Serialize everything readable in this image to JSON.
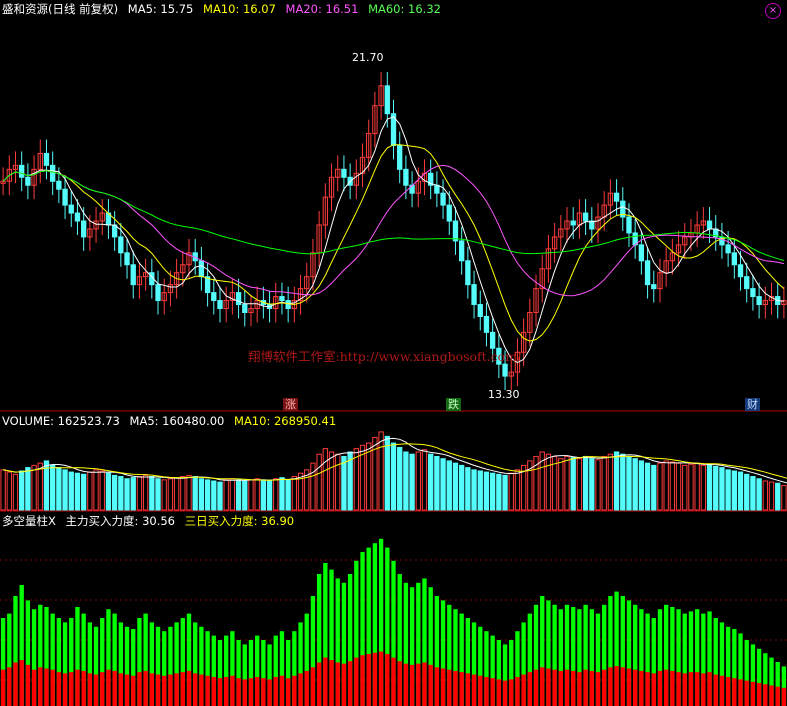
{
  "header": {
    "title": "盛和资源(日线 前复权)",
    "ma5": "MA5: 15.75",
    "ma10": "MA10: 16.07",
    "ma20": "MA20: 16.51",
    "ma60": "MA60: 16.32"
  },
  "volume_header": {
    "volume": "VOLUME: 162523.73",
    "ma5": "MA5: 160480.00",
    "ma10": "MA10: 268950.41"
  },
  "indicator_header": {
    "name": "多空量柱X",
    "main_force": "主力买入力度: 30.56",
    "three_day": "三日买入力度: 36.90"
  },
  "signals": {
    "zhang": "涨",
    "die": "跌",
    "cai": "财"
  },
  "watermark": "翔博软件工作室:http://www.xiangbosoft.com/",
  "icons": {
    "close": "close-icon"
  },
  "colors": {
    "up": "#ff3c3c",
    "down": "#54fcfc",
    "ma5": "#ffffff",
    "ma10": "#ffff00",
    "ma20": "#ff55ff",
    "ma60": "#00ff00",
    "bar_red": "#ff0000",
    "bar_green": "#00ff00"
  },
  "chart_data": [
    {
      "type": "candlestick",
      "panel": "price",
      "ylim": [
        13.3,
        21.7
      ],
      "high_label": "21.70",
      "low_label": "13.30",
      "close": [
        18.6,
        18.9,
        19.0,
        18.7,
        18.5,
        18.9,
        19.3,
        19.0,
        18.6,
        18.4,
        18.0,
        17.8,
        17.6,
        17.2,
        17.4,
        17.6,
        17.8,
        17.5,
        17.2,
        16.8,
        16.5,
        16.0,
        16.2,
        16.3,
        16.0,
        15.6,
        15.8,
        16.0,
        16.3,
        16.5,
        16.8,
        16.6,
        16.2,
        15.8,
        15.6,
        15.4,
        15.6,
        15.8,
        15.5,
        15.3,
        15.4,
        15.6,
        15.5,
        15.4,
        15.7,
        15.6,
        15.4,
        15.6,
        15.9,
        16.2,
        16.8,
        17.5,
        18.2,
        18.7,
        18.9,
        18.7,
        18.5,
        18.8,
        19.2,
        19.8,
        20.5,
        21.0,
        20.3,
        19.5,
        18.9,
        18.5,
        18.3,
        18.6,
        18.8,
        18.5,
        18.3,
        18.0,
        17.6,
        17.1,
        16.6,
        16.0,
        15.5,
        15.2,
        14.8,
        14.4,
        14.0,
        13.7,
        13.8,
        14.3,
        14.8,
        15.3,
        15.9,
        16.4,
        16.9,
        17.2,
        17.4,
        17.6,
        17.5,
        17.8,
        17.6,
        17.4,
        17.7,
        18.0,
        18.3,
        18.1,
        17.7,
        17.3,
        17.0,
        16.6,
        16.0,
        15.9,
        16.3,
        16.6,
        16.8,
        17.0,
        17.2,
        17.3,
        17.5,
        17.6,
        17.4,
        17.2,
        17.0,
        16.8,
        16.5,
        16.2,
        15.9,
        15.7,
        15.5,
        15.6,
        15.7,
        15.5,
        15.6
      ]
    },
    {
      "type": "bar",
      "panel": "volume",
      "values": [
        36,
        34,
        32,
        35,
        38,
        40,
        42,
        44,
        40,
        38,
        36,
        34,
        33,
        32,
        34,
        36,
        35,
        33,
        31,
        30,
        28,
        29,
        30,
        31,
        30,
        28,
        27,
        28,
        29,
        30,
        31,
        30,
        28,
        27,
        26,
        25,
        27,
        28,
        27,
        26,
        27,
        28,
        27,
        26,
        28,
        29,
        27,
        30,
        33,
        36,
        42,
        50,
        55,
        52,
        50,
        48,
        52,
        55,
        58,
        60,
        65,
        70,
        66,
        60,
        56,
        52,
        50,
        52,
        54,
        50,
        48,
        46,
        44,
        42,
        40,
        38,
        36,
        35,
        34,
        33,
        32,
        31,
        33,
        36,
        40,
        44,
        48,
        52,
        50,
        48,
        46,
        48,
        47,
        46,
        48,
        46,
        45,
        48,
        50,
        52,
        50,
        48,
        46,
        44,
        42,
        40,
        42,
        44,
        43,
        42,
        40,
        41,
        42,
        40,
        41,
        39,
        38,
        36,
        35,
        34,
        32,
        30,
        28,
        26,
        25,
        24,
        22,
        21
      ]
    },
    {
      "type": "bar",
      "panel": "indicator",
      "series": [
        {
          "values": [
            40,
            42,
            50,
            55,
            48,
            44,
            46,
            45,
            42,
            40,
            38,
            40,
            45,
            42,
            38,
            36,
            40,
            44,
            42,
            38,
            36,
            35,
            40,
            42,
            38,
            36,
            34,
            36,
            38,
            40,
            42,
            38,
            36,
            34,
            32,
            30,
            32,
            34,
            30,
            28,
            30,
            32,
            30,
            28,
            32,
            34,
            30,
            34,
            38,
            42,
            50,
            60,
            65,
            62,
            58,
            56,
            60,
            66,
            70,
            72,
            74,
            76,
            72,
            66,
            60,
            56,
            54,
            56,
            58,
            54,
            50,
            48,
            46,
            44,
            42,
            40,
            38,
            36,
            34,
            32,
            30,
            28,
            30,
            34,
            38,
            42,
            46,
            50,
            48,
            46,
            44,
            46,
            45,
            44,
            46,
            44,
            42,
            46,
            50,
            52,
            50,
            48,
            46,
            44,
            42,
            40,
            44,
            46,
            45,
            44,
            42,
            43,
            44,
            42,
            43,
            40,
            38,
            36,
            35,
            33,
            30,
            28,
            26,
            24,
            22,
            20,
            18,
            16
          ]
        },
        {
          "values": [
            30,
            32,
            36,
            38,
            34,
            30,
            32,
            31,
            30,
            28,
            27,
            28,
            30,
            29,
            27,
            26,
            28,
            30,
            29,
            27,
            26,
            25,
            28,
            29,
            27,
            26,
            25,
            26,
            27,
            28,
            29,
            27,
            26,
            25,
            24,
            23,
            24,
            25,
            23,
            22,
            23,
            24,
            23,
            22,
            24,
            25,
            23,
            25,
            27,
            29,
            32,
            36,
            40,
            38,
            36,
            35,
            37,
            40,
            42,
            43,
            44,
            45,
            43,
            40,
            37,
            35,
            34,
            35,
            36,
            34,
            32,
            31,
            30,
            29,
            28,
            27,
            26,
            25,
            24,
            23,
            22,
            21,
            22,
            24,
            26,
            28,
            30,
            32,
            31,
            30,
            29,
            30,
            29,
            28,
            30,
            29,
            28,
            30,
            32,
            33,
            32,
            31,
            30,
            29,
            28,
            27,
            29,
            30,
            29,
            28,
            27,
            28,
            28,
            27,
            28,
            26,
            25,
            24,
            23,
            22,
            21,
            20,
            19,
            18,
            17,
            16,
            15,
            14
          ]
        }
      ]
    }
  ]
}
